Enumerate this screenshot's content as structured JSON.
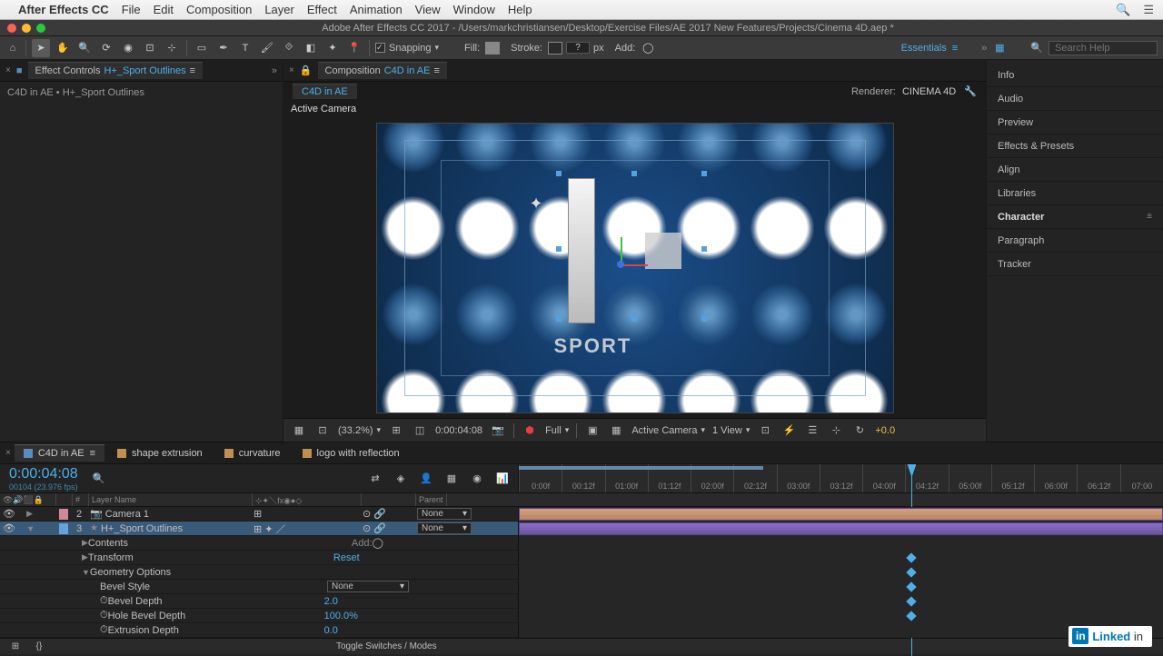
{
  "mac_menu": {
    "app_name": "After Effects CC",
    "items": [
      "File",
      "Edit",
      "Composition",
      "Layer",
      "Effect",
      "Animation",
      "View",
      "Window",
      "Help"
    ]
  },
  "title_bar": "Adobe After Effects CC 2017 - /Users/markchristiansen/Desktop/Exercise Files/AE 2017 New Features/Projects/Cinema 4D.aep *",
  "toolbar": {
    "snapping": "Snapping",
    "fill": "Fill:",
    "stroke": "Stroke:",
    "stroke_px_unit": "px",
    "stroke_val": "?",
    "add": "Add:",
    "workspace": "Essentials",
    "search_placeholder": "Search Help"
  },
  "effects_panel": {
    "title_prefix": "Effect Controls",
    "title_link": "H+_Sport Outlines",
    "breadcrumb": "C4D in AE • H+_Sport Outlines"
  },
  "comp_panel": {
    "title_prefix": "Composition",
    "title_link": "C4D in AE",
    "inner_tab": "C4D in AE",
    "renderer_label": "Renderer:",
    "renderer_value": "CINEMA 4D",
    "active_camera": "Active Camera",
    "sport_text": "SPORT",
    "footer": {
      "zoom": "(33.2%)",
      "time": "0:00:04:08",
      "res": "Full",
      "view_cam": "Active Camera",
      "views": "1 View",
      "exposure": "+0.0"
    }
  },
  "right_tabs": [
    "Info",
    "Audio",
    "Preview",
    "Effects & Presets",
    "Align",
    "Libraries",
    "Character",
    "Paragraph",
    "Tracker"
  ],
  "timeline": {
    "tabs": [
      {
        "name": "C4D in AE",
        "active": true
      },
      {
        "name": "shape extrusion",
        "active": false
      },
      {
        "name": "curvature",
        "active": false
      },
      {
        "name": "logo with reflection",
        "active": false
      }
    ],
    "timecode": "0:00:04:08",
    "fps": "00104 (23.976 fps)",
    "columns": {
      "layer_name": "Layer Name",
      "parent": "Parent",
      "num": "#"
    },
    "ruler": [
      "0:00f",
      "00:12f",
      "01:00f",
      "01:12f",
      "02:00f",
      "02:12f",
      "03:00f",
      "03:12f",
      "04:00f",
      "04:12f",
      "05:00f",
      "05:12f",
      "06:00f",
      "06:12f",
      "07:00"
    ],
    "layers": [
      {
        "num": "2",
        "name": "Camera 1",
        "parent": "None",
        "color": "#d08898"
      },
      {
        "num": "3",
        "name": "H+_Sport Outlines",
        "parent": "None",
        "color": "#68a0d8",
        "selected": true
      }
    ],
    "props": {
      "contents": "Contents",
      "add": "Add:",
      "transform": "Transform",
      "reset": "Reset",
      "geometry": "Geometry Options",
      "bevel_style": {
        "label": "Bevel Style",
        "value": "None"
      },
      "bevel_depth": {
        "label": "Bevel Depth",
        "value": "2.0"
      },
      "hole_bevel": {
        "label": "Hole Bevel Depth",
        "value": "100.0%"
      },
      "extrusion": {
        "label": "Extrusion Depth",
        "value": "0.0"
      }
    },
    "toggle": "Toggle Switches / Modes"
  },
  "linkedin": "Linked"
}
